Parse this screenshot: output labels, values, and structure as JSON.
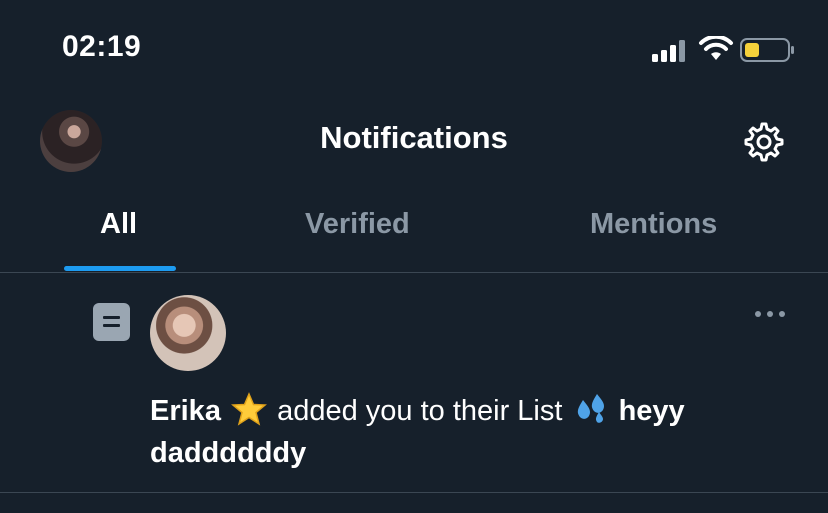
{
  "status_bar": {
    "time": "02:19",
    "battery_color": "#f5d13b"
  },
  "header": {
    "title": "Notifications",
    "settings_icon": "gear-icon"
  },
  "tabs": [
    {
      "label": "All",
      "active": true
    },
    {
      "label": "Verified",
      "active": false
    },
    {
      "label": "Mentions",
      "active": false
    }
  ],
  "colors": {
    "background": "#16202b",
    "accent": "#1d9bf0",
    "muted_text": "#8b98a5"
  },
  "notification": {
    "type_icon": "list-icon",
    "user_name": "Erika",
    "name_emoji": "star-emoji",
    "action_text": "added you to their List",
    "list_emoji": "sweat-droplets-emoji",
    "list_name": "heyy daddddddy",
    "more_icon": "more-horizontal-icon"
  }
}
